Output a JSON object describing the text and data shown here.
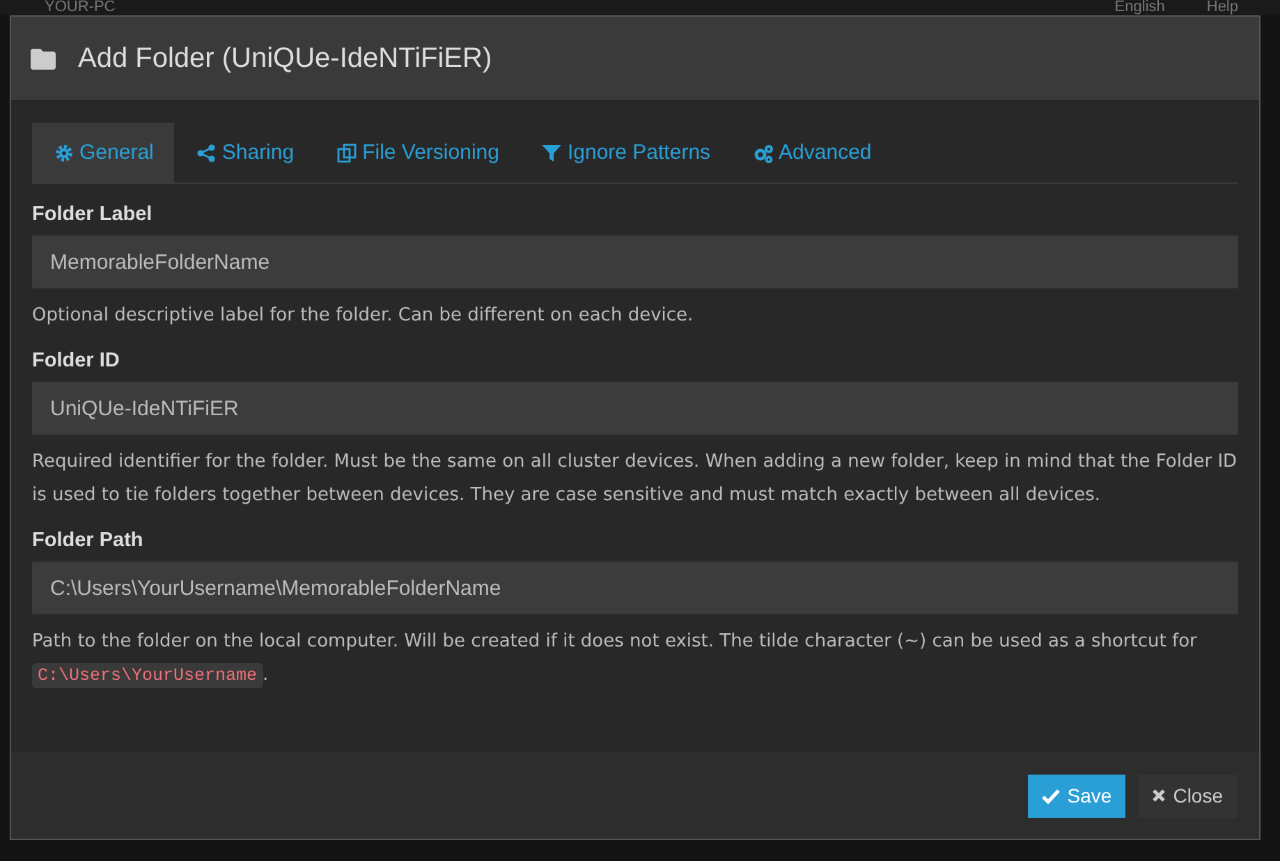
{
  "background": {
    "device_name": "YOUR-PC",
    "language": "English",
    "help": "Help"
  },
  "dialog": {
    "title": "Add Folder (UniQUe-IdeNTiFiER)",
    "tabs": [
      {
        "label": "General",
        "kind": "gear",
        "selected": true
      },
      {
        "label": "Sharing",
        "kind": "share",
        "selected": false
      },
      {
        "label": "File Versioning",
        "kind": "copy",
        "selected": false
      },
      {
        "label": "Ignore Patterns",
        "kind": "filter",
        "selected": false
      },
      {
        "label": "Advanced",
        "kind": "gears",
        "selected": false
      }
    ],
    "fields": [
      {
        "label": "Folder Label",
        "value": "MemorableFolderName",
        "help": "Optional descriptive label for the folder. Can be different on each device."
      },
      {
        "label": "Folder ID",
        "value": "UniQUe-IdeNTiFiER",
        "help": "Required identifier for the folder. Must be the same on all cluster devices. When adding a new folder, keep in mind that the Folder ID is used to tie folders together between devices. They are case sensitive and must match exactly between all devices."
      },
      {
        "label": "Folder Path",
        "value": "C:\\Users\\YourUsername\\MemorableFolderName",
        "help": "Path to the folder on the local computer. Will be created if it does not exist. The tilde character (~) can be used as a shortcut for",
        "help_code": "C:\\Users\\YourUsername",
        "help_end": "."
      }
    ],
    "buttons": [
      {
        "label": "Save",
        "kind": "primary"
      },
      {
        "label": "Close",
        "kind": "secondary"
      }
    ]
  }
}
